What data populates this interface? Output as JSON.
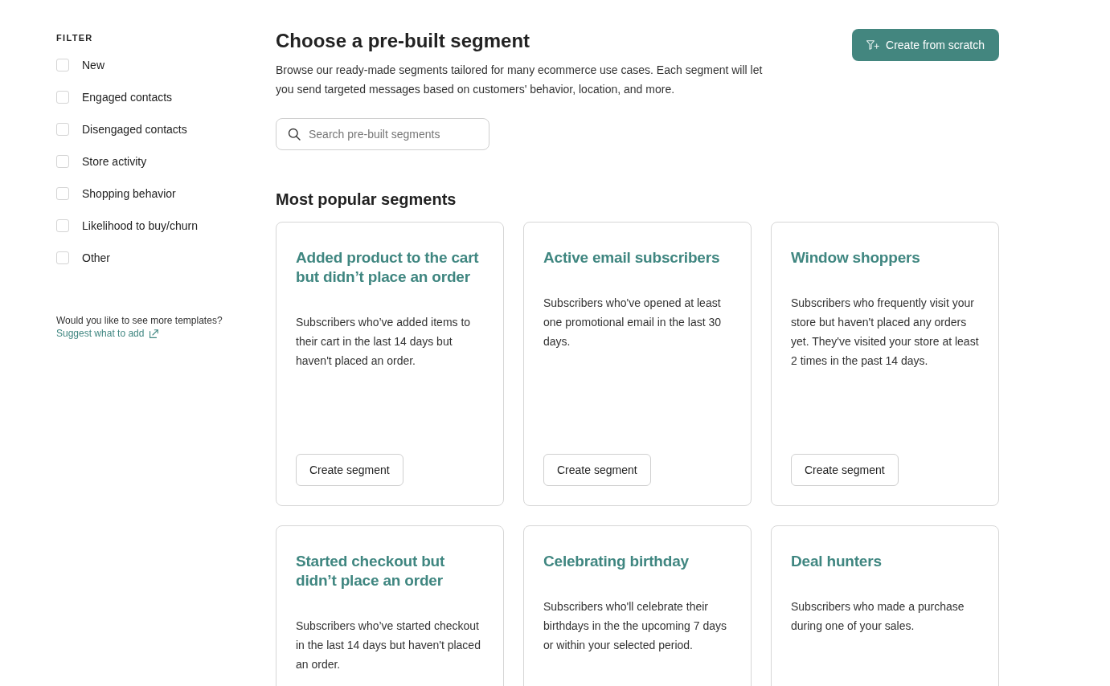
{
  "sidebar": {
    "heading": "FILTER",
    "filters": [
      {
        "label": "New",
        "checked": false
      },
      {
        "label": "Engaged contacts",
        "checked": false
      },
      {
        "label": "Disengaged contacts",
        "checked": false
      },
      {
        "label": "Store activity",
        "checked": false
      },
      {
        "label": "Shopping behavior",
        "checked": false
      },
      {
        "label": "Likelihood to buy/churn",
        "checked": false
      },
      {
        "label": "Other",
        "checked": false
      }
    ],
    "prompt": "Would you like to see more templates?",
    "link": "Suggest what to add"
  },
  "header": {
    "title": "Choose a pre-built segment",
    "description": "Browse our ready-made segments tailored for many ecommerce use cases. Each segment will let you send targeted messages based on customers' behavior, location, and more.",
    "primary_button": "Create from scratch"
  },
  "search": {
    "placeholder": "Search pre-built segments"
  },
  "section": {
    "title": "Most popular segments",
    "cards": [
      {
        "title": "Added product to the cart but didn’t place an order",
        "description": "Subscribers who’ve added items to their cart in the last 14 days but haven't placed an order.",
        "button": "Create segment"
      },
      {
        "title": "Active email subscribers",
        "description": "Subscribers who've opened at least one promotional email in the last 30 days.",
        "button": "Create segment"
      },
      {
        "title": "Window shoppers",
        "description": "Subscribers who frequently visit your store but haven't placed any orders yet. They've visited your store at least 2 times in the past 14 days.",
        "button": "Create segment"
      },
      {
        "title": "Started checkout but didn’t place an order",
        "description": "Subscribers who’ve started checkout in the last 14 days but haven't placed an order."
      },
      {
        "title": "Celebrating birthday",
        "description": "Subscribers who'll celebrate their birthdays in the the upcoming 7 days or within your selected period."
      },
      {
        "title": "Deal hunters",
        "description": "Subscribers who made a purchase during one of your sales."
      }
    ]
  }
}
